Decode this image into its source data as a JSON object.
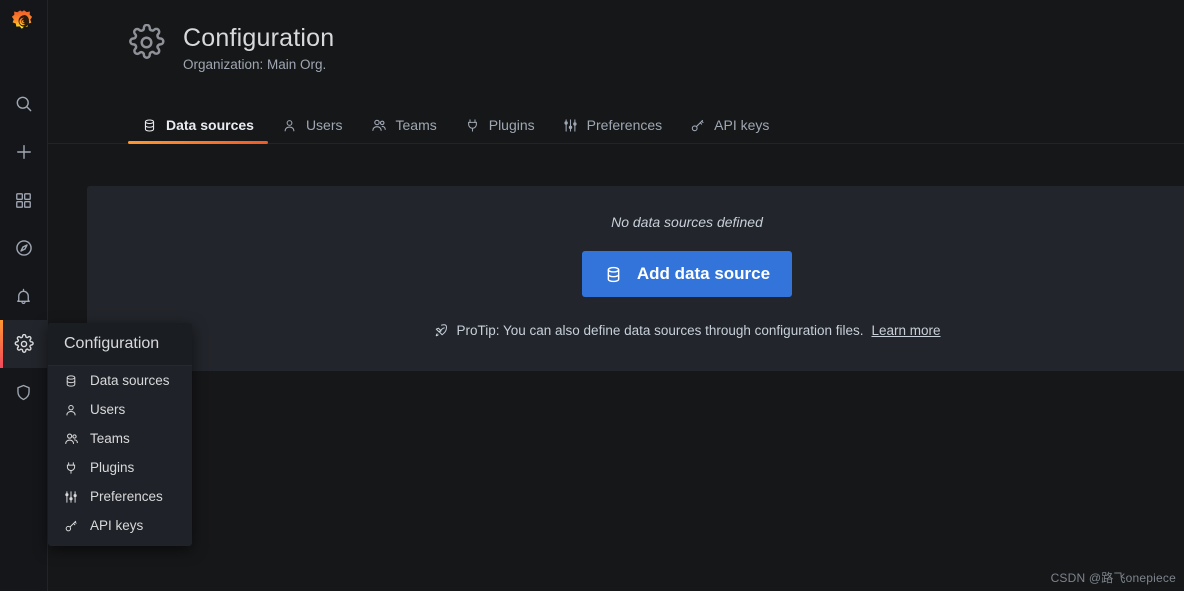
{
  "sidebar": {
    "logo": "grafana-logo",
    "items": [
      {
        "name": "search",
        "icon": "search-icon",
        "active": false
      },
      {
        "name": "create",
        "icon": "plus-icon",
        "active": false
      },
      {
        "name": "dashboards",
        "icon": "apps-grid-icon",
        "active": false
      },
      {
        "name": "explore",
        "icon": "compass-icon",
        "active": false
      },
      {
        "name": "alerting",
        "icon": "bell-icon",
        "active": false
      },
      {
        "name": "configuration",
        "icon": "gear-icon",
        "active": true
      },
      {
        "name": "server-admin",
        "icon": "shield-icon",
        "active": false
      }
    ]
  },
  "header": {
    "icon": "gear-icon",
    "title": "Configuration",
    "subtitle": "Organization: Main Org."
  },
  "tabs": [
    {
      "label": "Data sources",
      "icon": "database-icon",
      "active": true
    },
    {
      "label": "Users",
      "icon": "user-icon",
      "active": false
    },
    {
      "label": "Teams",
      "icon": "users-icon",
      "active": false
    },
    {
      "label": "Plugins",
      "icon": "plug-icon",
      "active": false
    },
    {
      "label": "Preferences",
      "icon": "sliders-icon",
      "active": false
    },
    {
      "label": "API keys",
      "icon": "key-icon",
      "active": false
    }
  ],
  "content": {
    "empty_message": "No data sources defined",
    "add_button_label": "Add data source",
    "add_button_icon": "database-icon",
    "protip_icon": "rocket-icon",
    "protip_text": "ProTip: You can also define data sources through configuration files.",
    "protip_link": "Learn more"
  },
  "flyout": {
    "title": "Configuration",
    "items": [
      {
        "label": "Data sources",
        "icon": "database-icon"
      },
      {
        "label": "Users",
        "icon": "user-icon"
      },
      {
        "label": "Teams",
        "icon": "users-icon"
      },
      {
        "label": "Plugins",
        "icon": "plug-icon"
      },
      {
        "label": "Preferences",
        "icon": "sliders-icon"
      },
      {
        "label": "API keys",
        "icon": "key-icon"
      }
    ]
  },
  "watermark": "CSDN @路飞onepiece",
  "colors": {
    "accent_orange": "#ff9830",
    "accent_red": "#f05a28",
    "primary_blue": "#3274d9",
    "panel_bg": "#22252b",
    "app_bg": "#161719"
  }
}
